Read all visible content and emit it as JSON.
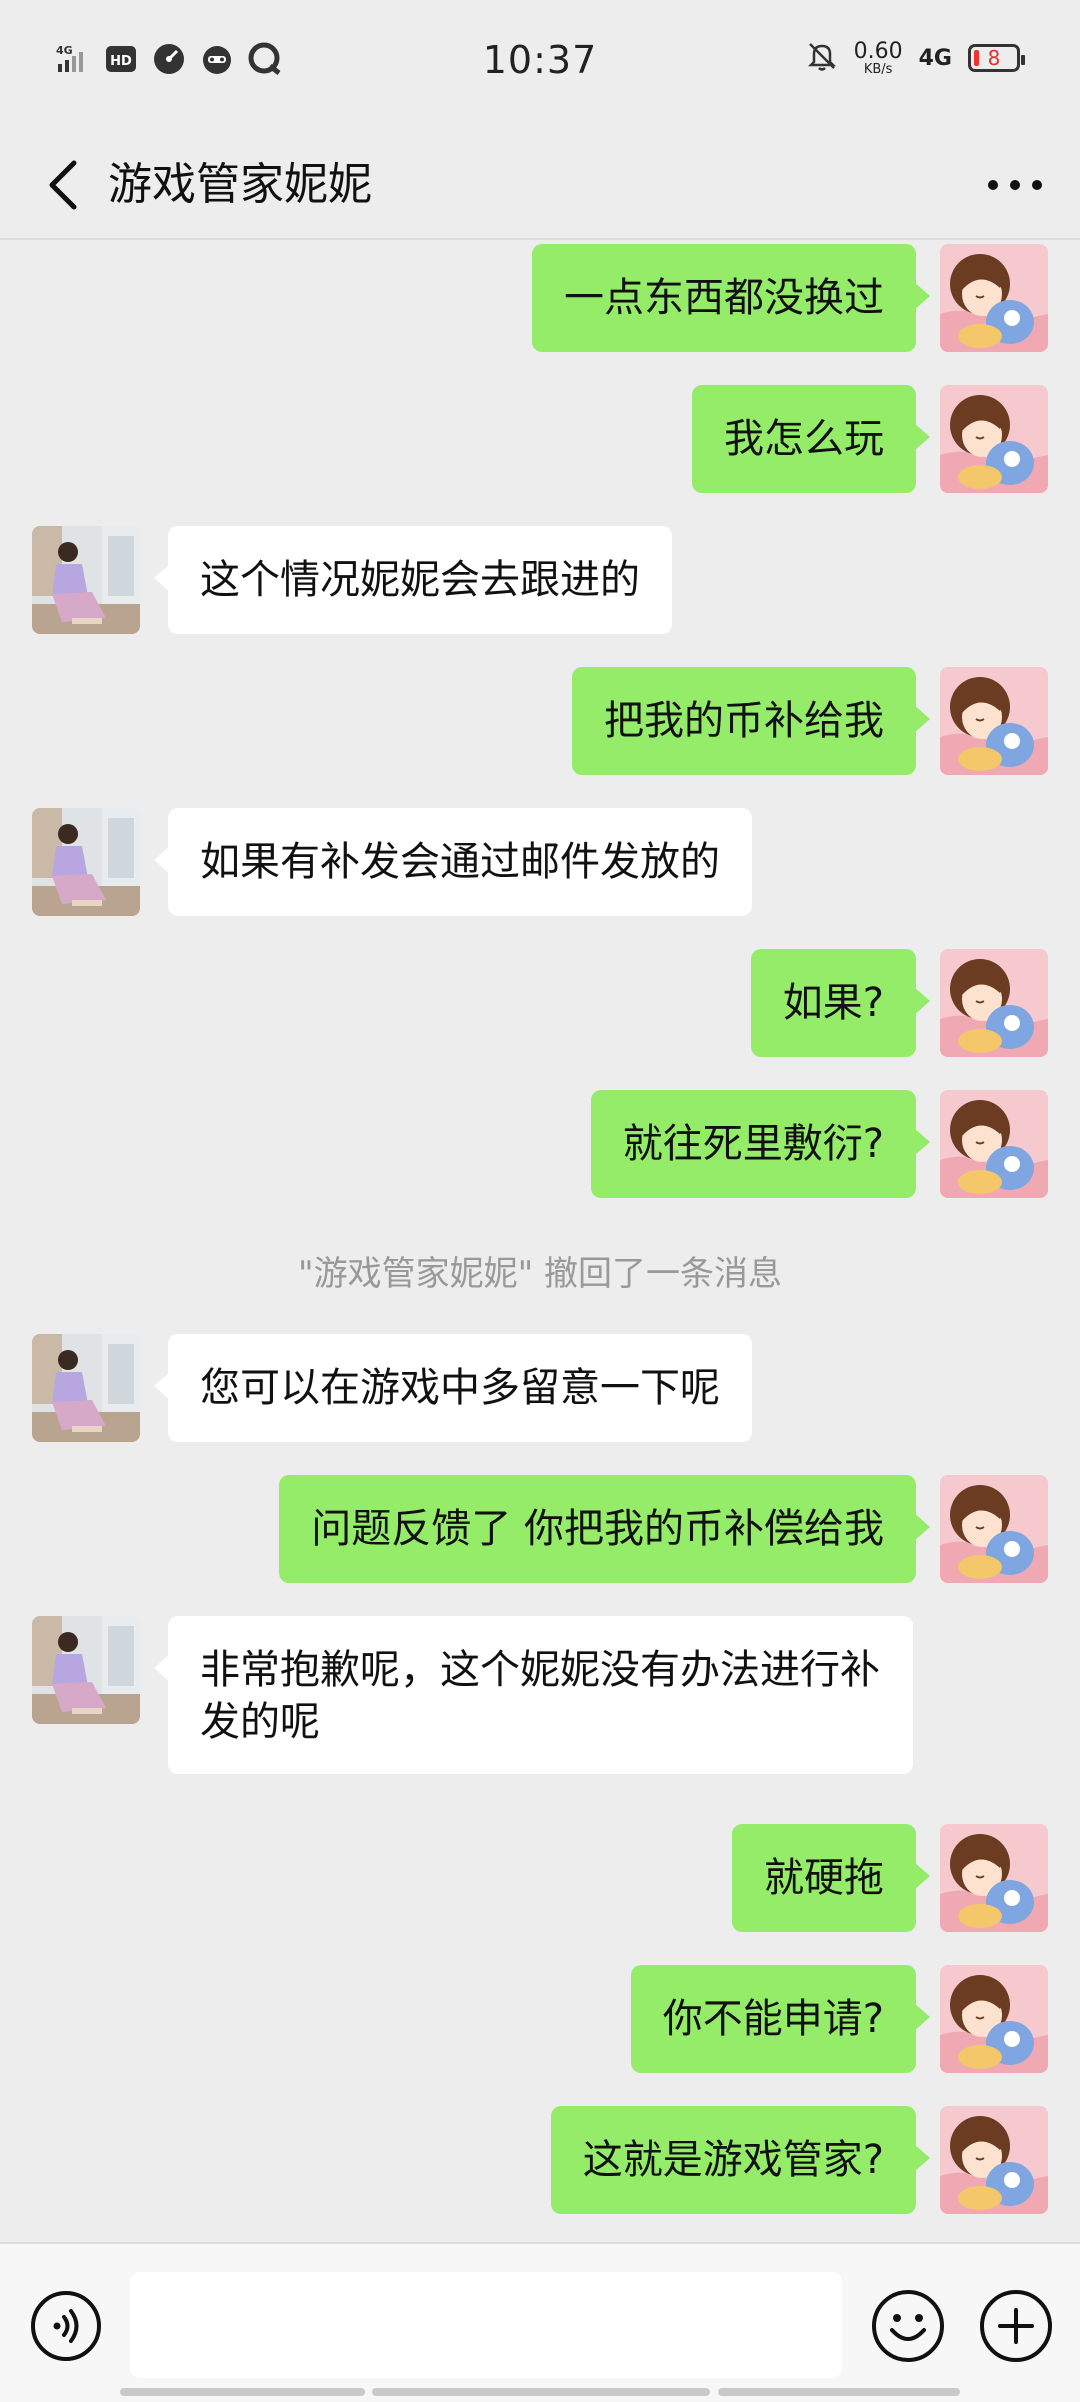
{
  "status_bar": {
    "time": "10:37",
    "signal_label": "4G",
    "hd_label": "HD",
    "net_speed": "0.60",
    "net_unit": "KB/s",
    "network": "4G",
    "battery": "8",
    "icons": [
      "signal-4g-icon",
      "hd-icon",
      "speedometer-icon",
      "mascot-icon",
      "chat-bubble-icon",
      "mute-bell-icon"
    ]
  },
  "header": {
    "title": "游戏管家妮妮",
    "back_icon": "chevron-left-icon",
    "more_icon": "more-dots-icon"
  },
  "messages": [
    {
      "from": "me",
      "text": "一点东西都没换过"
    },
    {
      "from": "me",
      "text": "我怎么玩"
    },
    {
      "from": "them",
      "text": "这个情况妮妮会去跟进的"
    },
    {
      "from": "me",
      "text": "把我的币补给我"
    },
    {
      "from": "them",
      "text": "如果有补发会通过邮件发放的"
    },
    {
      "from": "me",
      "text": "如果?"
    },
    {
      "from": "me",
      "text": "就往死里敷衍?"
    },
    {
      "from": "system",
      "text": "\"游戏管家妮妮\" 撤回了一条消息"
    },
    {
      "from": "them",
      "text": "您可以在游戏中多留意一下呢"
    },
    {
      "from": "me",
      "text": "问题反馈了 你把我的币补偿给我"
    },
    {
      "from": "them",
      "text": "非常抱歉呢，这个妮妮没有办法进行补发的呢"
    },
    {
      "from": "me",
      "text": "就硬拖"
    },
    {
      "from": "me",
      "text": "你不能申请?"
    },
    {
      "from": "me",
      "text": "这就是游戏管家?"
    }
  ],
  "input_bar": {
    "value": "",
    "icons": [
      "voice-icon",
      "emoji-icon",
      "plus-icon"
    ]
  },
  "colors": {
    "background": "#ededed",
    "my_bubble": "#95ec69",
    "their_bubble": "#ffffff",
    "recall_text": "#999999"
  }
}
